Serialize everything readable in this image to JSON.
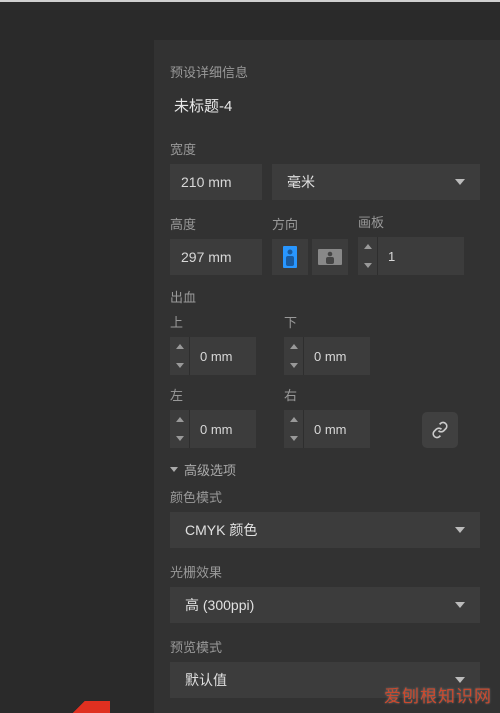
{
  "header": {
    "preset_details": "预设详细信息"
  },
  "document": {
    "title": "未标题-4",
    "width_label": "宽度",
    "width_value": "210 mm",
    "unit_label": "毫米",
    "height_label": "高度",
    "height_value": "297 mm",
    "orientation_label": "方向",
    "artboards_label": "画板",
    "artboards_value": "1"
  },
  "bleed": {
    "section": "出血",
    "top_label": "上",
    "top_value": "0 mm",
    "bottom_label": "下",
    "bottom_value": "0 mm",
    "left_label": "左",
    "left_value": "0 mm",
    "right_label": "右",
    "right_value": "0 mm"
  },
  "advanced": {
    "toggle": "高级选项",
    "color_mode_label": "颜色模式",
    "color_mode_value": "CMYK 颜色",
    "raster_label": "光栅效果",
    "raster_value": "高 (300ppi)",
    "preview_label": "预览模式",
    "preview_value": "默认值"
  },
  "watermark": "爱刨根知识网"
}
